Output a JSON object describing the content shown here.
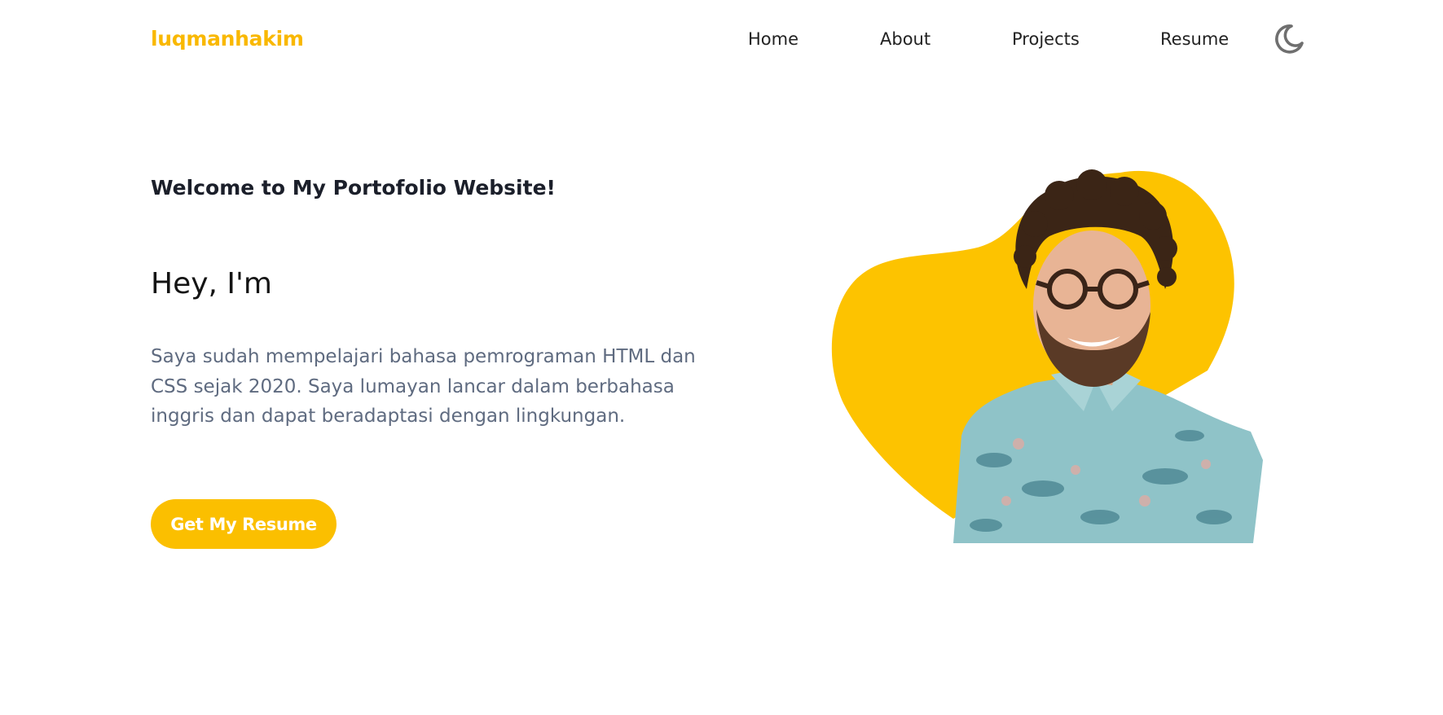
{
  "navbar": {
    "logo": "luqmanhakim",
    "links": [
      {
        "label": "Home"
      },
      {
        "label": "About"
      },
      {
        "label": "Projects"
      },
      {
        "label": "Resume"
      }
    ],
    "theme_toggle_icon": "moon-icon"
  },
  "hero": {
    "welcome": "Welcome to My Portofolio Website!",
    "greeting": "Hey, I'm",
    "description": "Saya sudah mempelajari bahasa pemrograman HTML dan CSS sejak 2020. Saya lumayan lancar dalam berbahasa inggris dan dapat beradaptasi dengan lingkungan.",
    "cta_label": "Get My Resume",
    "image": "profile-photo"
  },
  "colors": {
    "accent": "#fbbf00",
    "text_dark": "#1b1f2a",
    "text_muted": "#5f6b80"
  }
}
